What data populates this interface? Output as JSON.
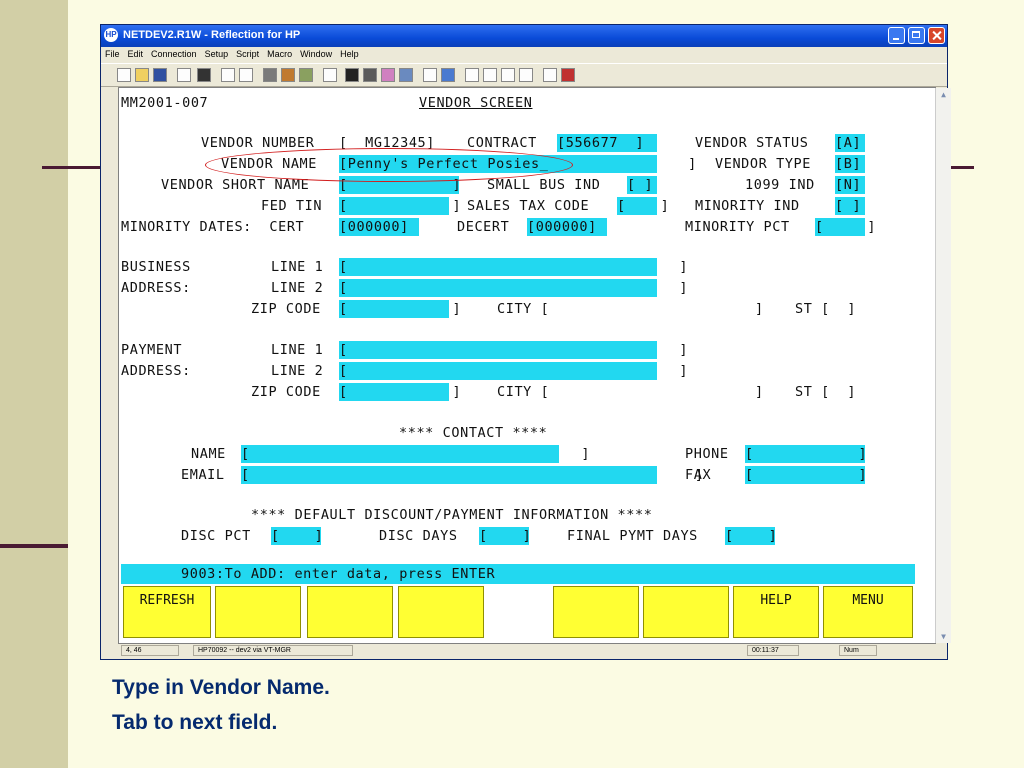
{
  "window": {
    "title": "NETDEV2.R1W - Reflection for HP",
    "app_icon": "HP",
    "menu": [
      "File",
      "Edit",
      "Connection",
      "Setup",
      "Script",
      "Macro",
      "Window",
      "Help"
    ]
  },
  "screen": {
    "screen_id": "MM2001-007",
    "title": "VENDOR SCREEN",
    "vendor_number_label": "VENDOR NUMBER",
    "vendor_number_value": "[  MG12345]",
    "contract_label": "CONTRACT",
    "contract_value": "[556677  ]",
    "vendor_status_label": "VENDOR STATUS",
    "vendor_status_value": "[A]",
    "vendor_name_label": "VENDOR NAME",
    "vendor_name_value": "[Penny's Perfect Posies_                ]",
    "vendor_type_label": "VENDOR TYPE",
    "vendor_type_value": "[B]",
    "vendor_short_name_label": "VENDOR SHORT NAME",
    "vendor_short_name_value": "[            ]",
    "small_bus_label": "SMALL BUS IND",
    "small_bus_value": "[ ]",
    "ind_1099_label": "1099 IND",
    "ind_1099_value": "[N]",
    "fed_tin_label": "FED TIN",
    "fed_tin_value": "[            ]",
    "sales_tax_label": "SALES TAX CODE",
    "sales_tax_value": "[    ]",
    "minority_ind_label": "MINORITY IND",
    "minority_ind_value": "[ ]",
    "minority_dates_label": "MINORITY DATES:  CERT",
    "cert_value": "[000000]",
    "decert_label": "DECERT",
    "decert_value": "[000000]",
    "minority_pct_label": "MINORITY PCT",
    "minority_pct_value": "[     ]",
    "business_label_1": "BUSINESS",
    "business_label_2": "ADDRESS:",
    "payment_label_1": "PAYMENT",
    "payment_label_2": "ADDRESS:",
    "line1_label": "LINE 1",
    "line2_label": "LINE 2",
    "line_value": "[                                      ]",
    "zip_label": "ZIP CODE",
    "zip_value": "[            ]",
    "city_label": "CITY [",
    "city_close": "]",
    "st_label": "ST [  ]",
    "contact_header": "**** CONTACT ****",
    "name_label": "NAME",
    "name_value": "[                                      ]",
    "phone_label": "PHONE",
    "phone_value": "[            ]",
    "email_label": "EMAIL",
    "email_value": "[                                                   ]",
    "fax_label": "FAX",
    "fax_value": "[            ]",
    "discount_header": "**** DEFAULT DISCOUNT/PAYMENT INFORMATION ****",
    "disc_pct_label": "DISC PCT",
    "disc_pct_value": "[    ]",
    "disc_days_label": "DISC DAYS",
    "disc_days_value": "[    ]",
    "final_pymt_label": "FINAL PYMT DAYS",
    "final_pymt_value": "[    ]",
    "message": "9003:To ADD: enter data, press ENTER"
  },
  "function_keys": [
    "REFRESH",
    "",
    "",
    "",
    "",
    "",
    "",
    "HELP",
    "MENU"
  ],
  "status_bar": {
    "cursor": "4, 46",
    "connection": "HP70092 -- dev2 via VT-MGR",
    "time": "00:11:37",
    "num": "Num"
  },
  "captions": [
    "Type in Vendor Name.",
    "Tab to next field."
  ],
  "colors": {
    "field_cyan": "#22d8f0",
    "function_key_yellow": "#ffff33",
    "caption_blue": "#052a6e",
    "annotation_red": "#d21e1e"
  }
}
